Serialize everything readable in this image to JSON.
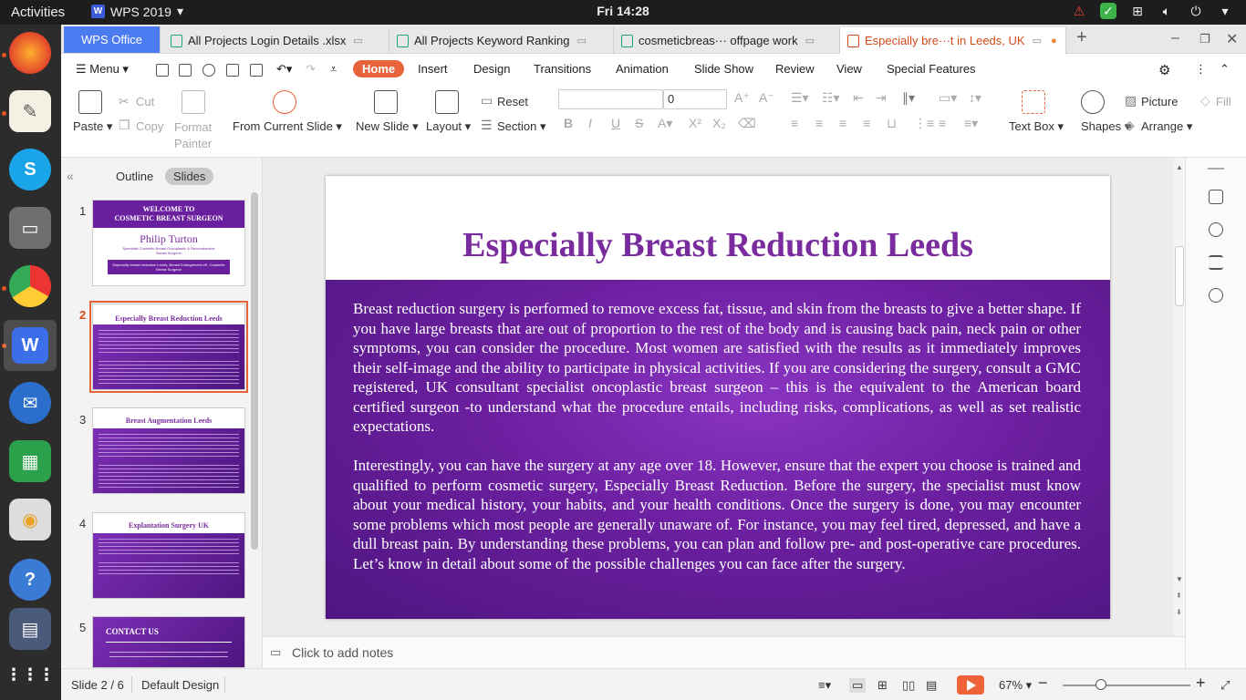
{
  "topbar": {
    "activities": "Activities",
    "app_name": "WPS 2019",
    "clock": "Fri 14:28"
  },
  "tabs": {
    "wps_office": "WPS Office",
    "items": [
      {
        "label": "All Projects Login Details .xlsx"
      },
      {
        "label": "All Projects Keyword Ranking"
      },
      {
        "label": "cosmeticbreas··· offpage work"
      },
      {
        "label": "Especially bre···t in Leeds, UK"
      }
    ],
    "new_tab": "+"
  },
  "menu": {
    "menu_label": "Menu",
    "items": [
      "Home",
      "Insert",
      "Design",
      "Transitions",
      "Animation",
      "Slide Show",
      "Review",
      "View",
      "Special Features"
    ]
  },
  "ribbon": {
    "paste": "Paste",
    "cut": "Cut",
    "copy": "Copy",
    "format_painter_1": "Format",
    "format_painter_2": "Painter",
    "from_current_slide": "From Current Slide",
    "new_slide": "New Slide",
    "layout": "Layout",
    "reset": "Reset",
    "section": "Section",
    "font_size": "0",
    "text_box": "Text Box",
    "shapes": "Shapes",
    "picture": "Picture",
    "arrange": "Arrange",
    "fill": "Fill"
  },
  "left_panel": {
    "outline_tab": "Outline",
    "slides_tab": "Slides",
    "thumbs": [
      {
        "num": "1",
        "title_1": "WELCOME TO",
        "title_2": "COSMETIC BREAST SURGEON",
        "name": "Philip Turton",
        "sub": "Specialist Cosmetic Breast Oncoplastic & Reconstructive Breast Surgeon",
        "link": "Especially breast reduction Leeds, Breast Enlargement UK, Cosmetic Breast Surgeon"
      },
      {
        "num": "2",
        "title": "Especially Breast Reduction Leeds"
      },
      {
        "num": "3",
        "title": "Breast Augmentation Leeds"
      },
      {
        "num": "4",
        "title": "Explantation Surgery UK"
      },
      {
        "num": "5",
        "title": "CONTACT US"
      }
    ]
  },
  "slide": {
    "title": "Especially Breast Reduction Leeds",
    "para1": "Breast reduction surgery is performed to remove excess fat, tissue, and skin from the breasts to give a better shape. If you have large breasts that are out of proportion to the rest of the body and is causing back pain, neck pain or other symptoms, you can consider the procedure. Most women are satisfied with the results as it immediately improves their self-image and the ability to participate in physical activities. If you are considering the surgery, consult a GMC registered, UK consultant specialist oncoplastic breast surgeon – this is the equivalent to the American board certified surgeon -to understand what the procedure entails, including risks, complications, as well as set realistic expectations.",
    "para2": "Interestingly, you can have the surgery at any age over 18. However, ensure that the expert you choose is trained and qualified to perform cosmetic surgery, Especially Breast Reduction. Before the surgery, the specialist must know about your medical history, your habits, and your health conditions. Once the surgery is done, you may encounter some problems which most people are generally unaware of. For instance, you may feel tired, depressed, and have a dull breast pain. By understanding these problems, you can plan and follow pre- and post-operative care procedures. Let’s know in detail about some of the possible challenges you can face after the surgery."
  },
  "notes": {
    "placeholder": "Click to add notes"
  },
  "status": {
    "slide_counter": "Slide 2 / 6",
    "design": "Default Design",
    "zoom": "67%"
  },
  "colors": {
    "accent": "#e8623a",
    "slide_title": "#7a2c9e",
    "slide_bg": "#6b1f9f"
  }
}
